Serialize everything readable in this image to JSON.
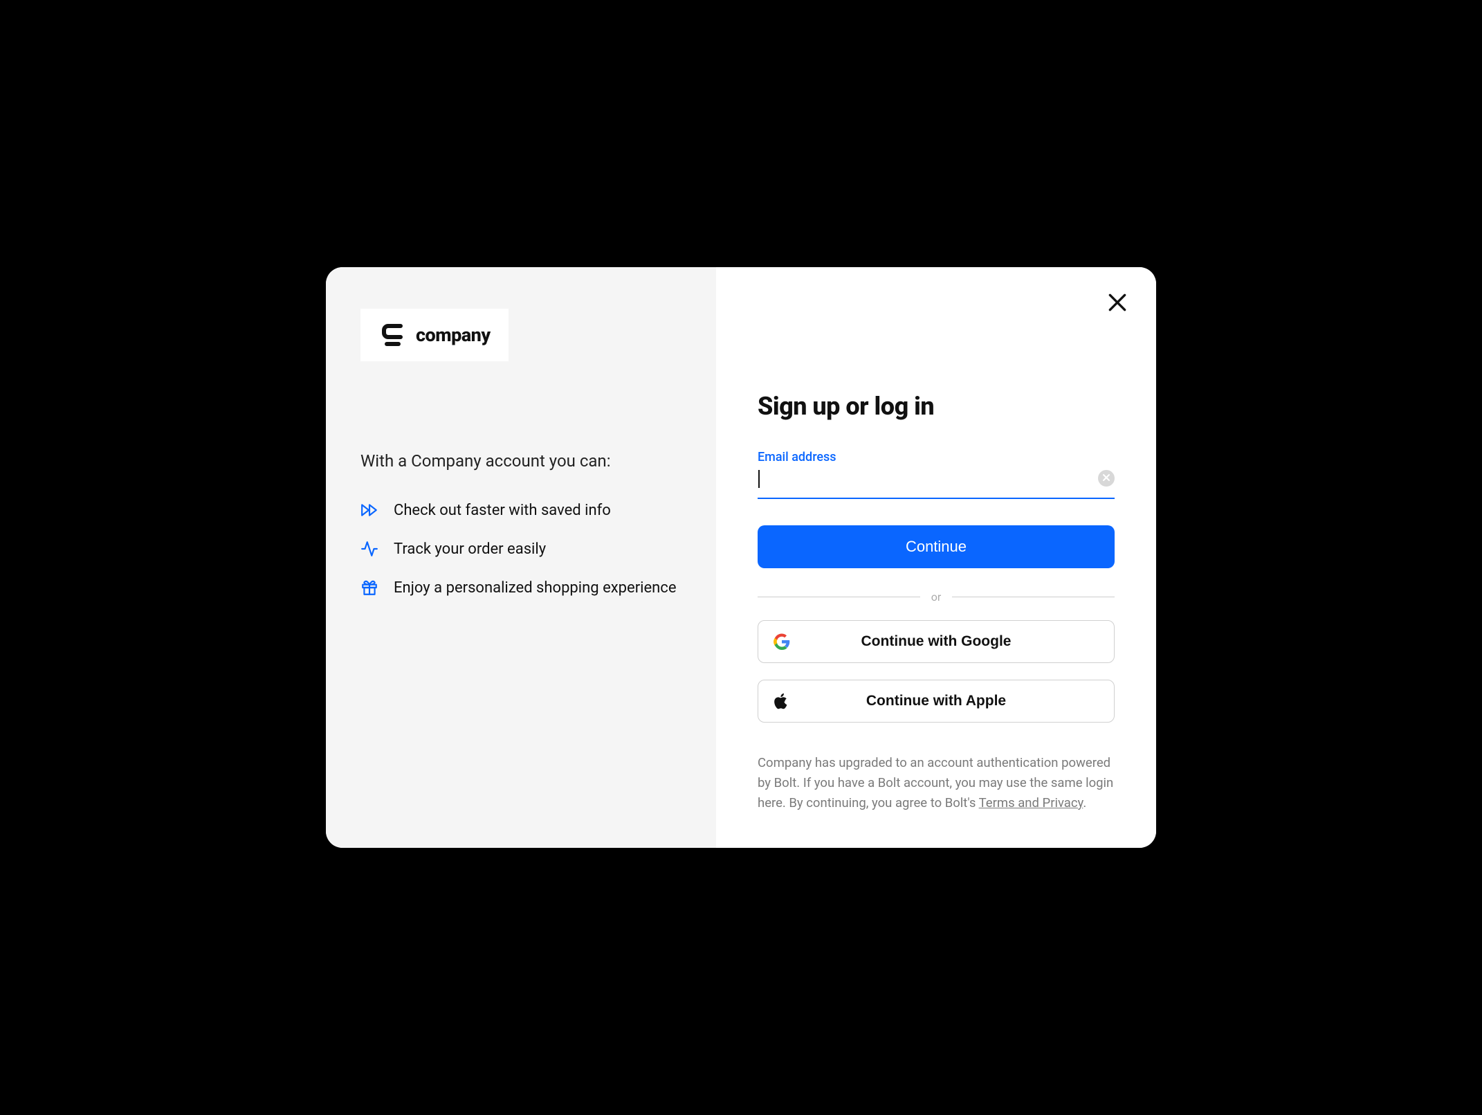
{
  "brand": {
    "name": "company"
  },
  "left": {
    "intro": "With a Company account you can:",
    "benefits": [
      {
        "icon": "fast-forward",
        "text": "Check out faster with saved info"
      },
      {
        "icon": "activity",
        "text": "Track your order easily"
      },
      {
        "icon": "gift",
        "text": "Enjoy a personalized shopping experience"
      }
    ]
  },
  "auth": {
    "title": "Sign up or log in",
    "email_label": "Email address",
    "email_value": "",
    "continue_label": "Continue",
    "divider_text": "or",
    "google_label": "Continue with Google",
    "apple_label": "Continue with Apple",
    "legal_text": "Company has upgraded to an account authentication powered by Bolt. If you have a Bolt account, you may use the same login here. By continuing, you agree to Bolt's ",
    "legal_link_text": "Terms and Privacy",
    "legal_suffix": "."
  },
  "colors": {
    "accent": "#0a66ff"
  }
}
